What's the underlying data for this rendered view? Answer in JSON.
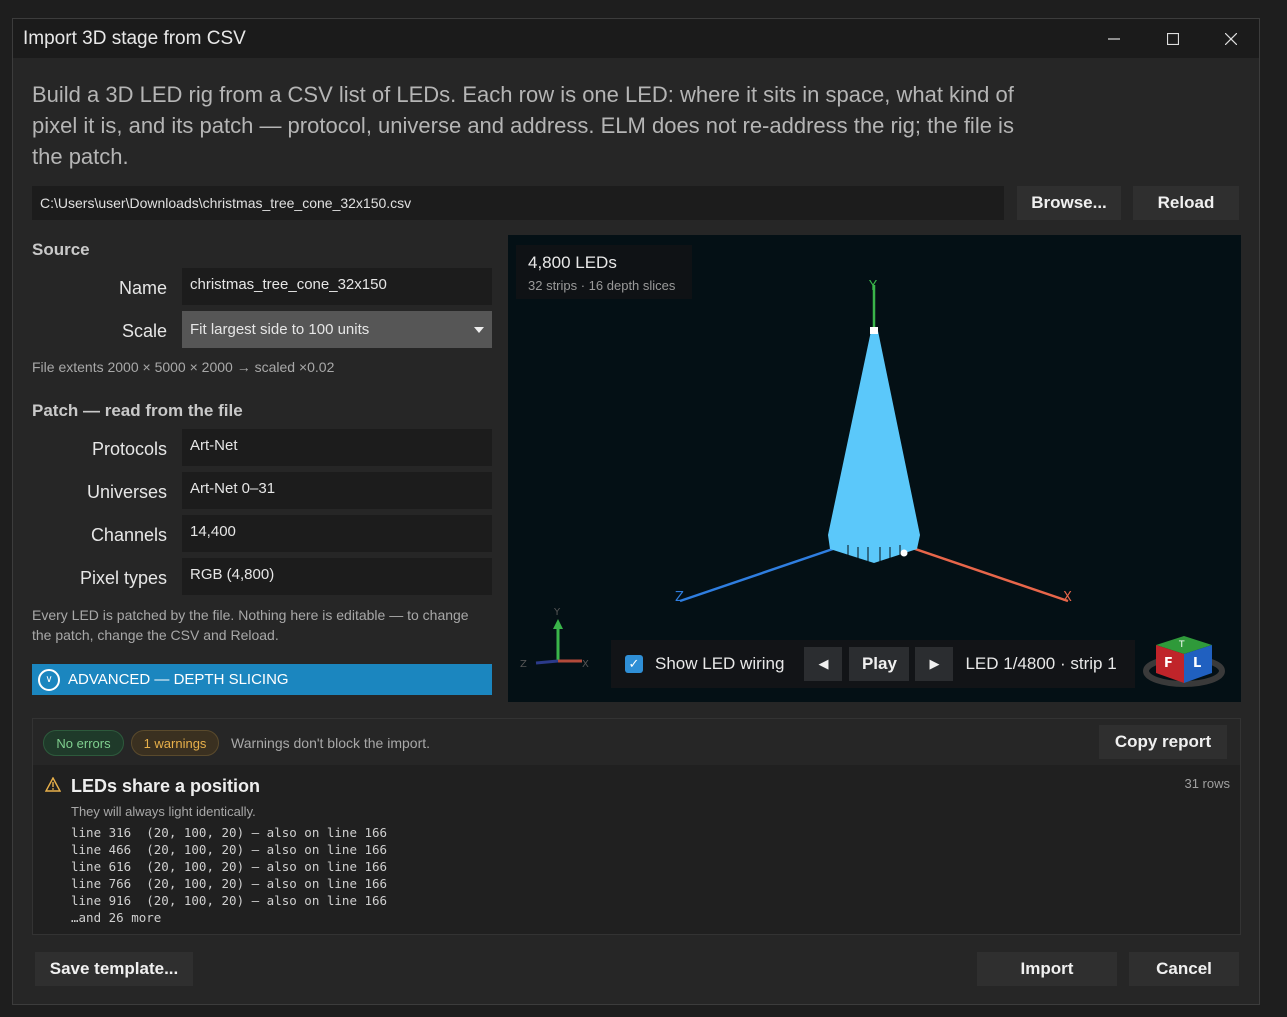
{
  "window": {
    "title": "Import 3D stage from CSV"
  },
  "intro": "Build a 3D LED rig from a CSV list of LEDs. Each row is one LED: where it sits in space, what kind of pixel it is, and its patch — protocol, universe and address. ELM does not re-address the rig; the file is the patch.",
  "file": {
    "path": "C:\\Users\\user\\Downloads\\christmas_tree_cone_32x150.csv",
    "browse_label": "Browse...",
    "reload_label": "Reload"
  },
  "source": {
    "heading": "Source",
    "name_label": "Name",
    "name_value": "christmas_tree_cone_32x150",
    "scale_label": "Scale",
    "scale_value": "Fit largest side to 100 units",
    "extents": "File extents 2000 × 5000 × 2000 → scaled ×0.02"
  },
  "patch": {
    "heading": "Patch — read from the file",
    "rows": [
      {
        "label": "Protocols",
        "value": "Art-Net"
      },
      {
        "label": "Universes",
        "value": "Art-Net 0–31"
      },
      {
        "label": "Channels",
        "value": "14,400"
      },
      {
        "label": "Pixel types",
        "value": "RGB (4,800)"
      }
    ],
    "note": "Every LED is patched by the file. Nothing here is editable — to change the patch, change the CSV and Reload."
  },
  "advanced": {
    "label": "ADVANCED — DEPTH SLICING"
  },
  "viewport": {
    "count": "4,800 LEDs",
    "sub": "32 strips · 16 depth slices",
    "axis_x": "X",
    "axis_y": "Y",
    "axis_z": "Z",
    "show_wiring_label": "Show LED wiring",
    "play_label": "Play",
    "led_status": "LED 1/4800 · strip 1",
    "cone_color": "#5bc8fa",
    "cube_labels": {
      "top": "T",
      "front": "F",
      "left": "L"
    }
  },
  "report": {
    "no_errors": "No errors",
    "warnings": "1 warnings",
    "warnings_note": "Warnings don't block the import.",
    "copy_label": "Copy report",
    "issue_title": "LEDs share a position",
    "issue_rows": "31 rows",
    "issue_desc": "They will always light identically.",
    "lines": [
      "line 316  (20, 100, 20) — also on line 166",
      "line 466  (20, 100, 20) — also on line 166",
      "line 616  (20, 100, 20) — also on line 166",
      "line 766  (20, 100, 20) — also on line 166",
      "line 916  (20, 100, 20) — also on line 166"
    ],
    "more": "…and 26 more"
  },
  "footer": {
    "save_label": "Save template...",
    "import_label": "Import",
    "cancel_label": "Cancel"
  }
}
